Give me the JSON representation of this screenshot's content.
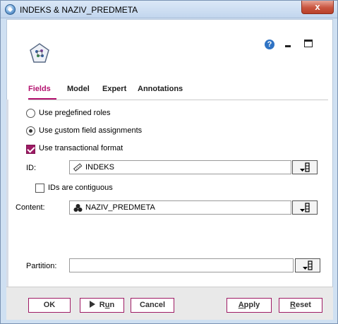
{
  "window": {
    "title": "INDEKS & NAZIV_PREDMETA",
    "close_glyph": "x"
  },
  "toolbar": {
    "help_glyph": "?"
  },
  "tabs": [
    {
      "label": "Fields",
      "active": true
    },
    {
      "label": "Model",
      "active": false
    },
    {
      "label": "Expert",
      "active": false
    },
    {
      "label": "Annotations",
      "active": false
    }
  ],
  "roles": {
    "predefined_prefix": "Use pre",
    "predefined_mnemonic": "d",
    "predefined_suffix": "efined roles",
    "custom_prefix": "Use ",
    "custom_mnemonic": "c",
    "custom_suffix": "ustom field assignments",
    "selected": "custom"
  },
  "transactional": {
    "label": "Use transactional format",
    "checked": true
  },
  "id_field": {
    "label": "ID:",
    "value": "INDEKS",
    "icon": "ruler-icon"
  },
  "contiguous": {
    "label": "IDs are contiguous",
    "checked": false
  },
  "content_field": {
    "label": "Content:",
    "value": "NAZIV_PREDMETA",
    "icon": "set-icon"
  },
  "partition_field": {
    "label": "Partition:",
    "value": ""
  },
  "buttons": {
    "ok": "OK",
    "run_prefix": "R",
    "run_mnemonic": "u",
    "run_suffix": "n",
    "cancel": "Cancel",
    "apply_prefix": "",
    "apply_mnemonic": "A",
    "apply_suffix": "pply",
    "reset_prefix": "",
    "reset_mnemonic": "R",
    "reset_suffix": "eset"
  },
  "colors": {
    "accent": "#b4126f",
    "titlebar": "#c2d6ee",
    "close": "#c9553f"
  }
}
